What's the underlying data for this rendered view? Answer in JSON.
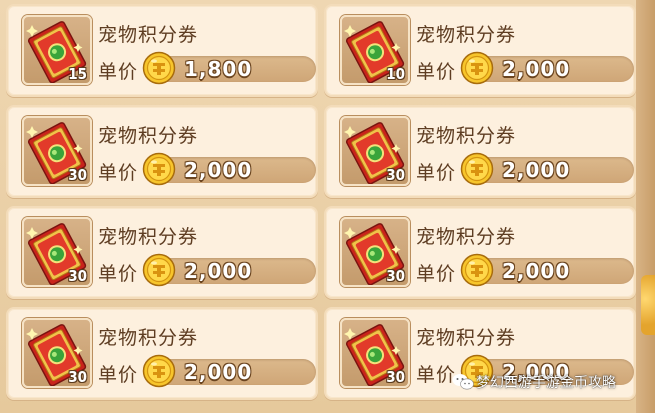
{
  "items": [
    {
      "name": "宠物积分券",
      "price_label": "单价",
      "price": "1,800",
      "count": "15"
    },
    {
      "name": "宠物积分券",
      "price_label": "单价",
      "price": "2,000",
      "count": "10"
    },
    {
      "name": "宠物积分券",
      "price_label": "单价",
      "price": "2,000",
      "count": "30"
    },
    {
      "name": "宠物积分券",
      "price_label": "单价",
      "price": "2,000",
      "count": "30"
    },
    {
      "name": "宠物积分券",
      "price_label": "单价",
      "price": "2,000",
      "count": "30"
    },
    {
      "name": "宠物积分券",
      "price_label": "单价",
      "price": "2,000",
      "count": "30"
    },
    {
      "name": "宠物积分券",
      "price_label": "单价",
      "price": "2,000",
      "count": "30"
    },
    {
      "name": "宠物积分券",
      "price_label": "单价",
      "price": "2,000",
      "count": "30"
    }
  ],
  "watermark": {
    "text": "梦幻西游手游金币攻略",
    "icon": "wechat-icon"
  },
  "colors": {
    "card_bg": "#fdf0de",
    "text": "#5e3d22",
    "coin": "#f2b51e",
    "ticket_red": "#c9241b",
    "gem_green": "#3aa43a"
  }
}
